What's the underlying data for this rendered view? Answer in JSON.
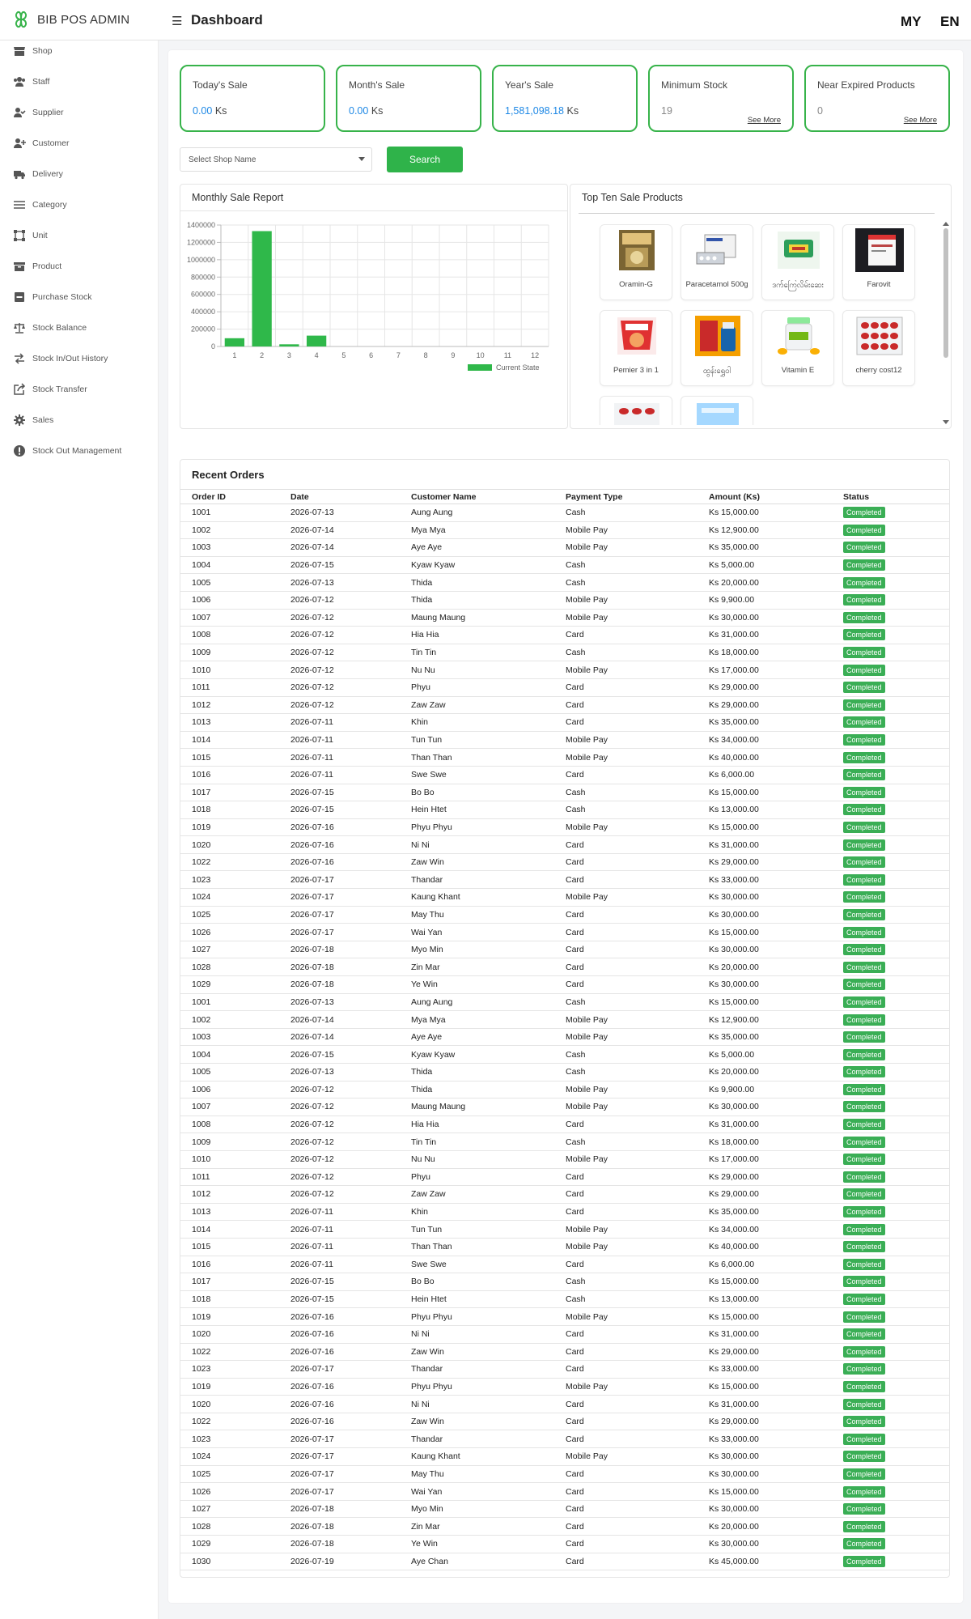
{
  "brand": {
    "name": "BIB POS ADMIN"
  },
  "header": {
    "title": "Dashboard",
    "lang_my": "MY",
    "lang_en": "EN"
  },
  "colors": {
    "accent": "#37b34a",
    "link": "#1e88e5",
    "badge": "#3aae55"
  },
  "sidebar": {
    "items": [
      {
        "label": "Shop",
        "icon": "store-icon"
      },
      {
        "label": "Staff",
        "icon": "users-icon"
      },
      {
        "label": "Supplier",
        "icon": "user-check-icon"
      },
      {
        "label": "Customer",
        "icon": "user-plus-icon"
      },
      {
        "label": "Delivery",
        "icon": "truck-icon"
      },
      {
        "label": "Category",
        "icon": "bars-icon"
      },
      {
        "label": "Unit",
        "icon": "vector-square-icon"
      },
      {
        "label": "Product",
        "icon": "box-icon"
      },
      {
        "label": "Purchase Stock",
        "icon": "minus-square-icon"
      },
      {
        "label": "Stock Balance",
        "icon": "scale-icon"
      },
      {
        "label": "Stock In/Out History",
        "icon": "exchange-icon"
      },
      {
        "label": "Stock Transfer",
        "icon": "share-square-icon"
      },
      {
        "label": "Sales",
        "icon": "cog-icon"
      },
      {
        "label": "Stock Out Management",
        "icon": "exclamation-circle-icon"
      }
    ]
  },
  "stats": {
    "today": {
      "title": "Today's Sale",
      "value": "0.00",
      "unit": "Ks"
    },
    "month": {
      "title": "Month's Sale",
      "value": "0.00",
      "unit": "Ks"
    },
    "year": {
      "title": "Year's Sale",
      "value": "1,581,098.18",
      "unit": "Ks"
    },
    "min_stock": {
      "title": "Minimum Stock",
      "value": "19",
      "link": "See More"
    },
    "near_expired": {
      "title": "Near Expired Products",
      "value": "0",
      "link": "See More"
    }
  },
  "filters": {
    "shop_placeholder": "Select Shop Name",
    "search_label": "Search"
  },
  "monthly_report": {
    "title": "Monthly Sale Report"
  },
  "chart_data": {
    "type": "bar",
    "categories": [
      "1",
      "2",
      "3",
      "4",
      "5",
      "6",
      "7",
      "8",
      "9",
      "10",
      "11",
      "12"
    ],
    "series": [
      {
        "name": "Current State",
        "color": "#2fb84a",
        "values": [
          95000,
          1330000,
          25000,
          125000,
          0,
          0,
          0,
          0,
          0,
          0,
          0,
          0
        ]
      }
    ],
    "yticks": [
      "0",
      "200000",
      "400000",
      "600000",
      "800000",
      "1000000",
      "1200000",
      "1400000"
    ],
    "ylim": [
      0,
      1400000
    ],
    "grid": true,
    "legend": "bottom-right"
  },
  "top_products": {
    "title": "Top Ten Sale Products",
    "items": [
      {
        "name": "Oramin-G"
      },
      {
        "name": "Paracetamol 500g"
      },
      {
        "name": "ဒက်ကြေလိမ်းဆေး"
      },
      {
        "name": "Farovit"
      },
      {
        "name": "Pemier 3 in 1"
      },
      {
        "name": "ထွန်းရွှေဝါ"
      },
      {
        "name": "Vitamin E"
      },
      {
        "name": "cherry cost12"
      },
      {
        "name": ""
      },
      {
        "name": ""
      }
    ]
  },
  "orders": {
    "title": "Recent Orders",
    "columns": [
      "Order ID",
      "Date",
      "Customer Name",
      "Payment Type",
      "Amount (Ks)",
      "Status"
    ],
    "rows": [
      [
        "1001",
        "2026-07-13",
        "Aung Aung",
        "Cash",
        "Ks 15,000.00",
        "Completed"
      ],
      [
        "1002",
        "2026-07-14",
        "Mya Mya",
        "Mobile Pay",
        "Ks 12,900.00",
        "Completed"
      ],
      [
        "1003",
        "2026-07-14",
        "Aye Aye",
        "Mobile Pay",
        "Ks 35,000.00",
        "Completed"
      ],
      [
        "1004",
        "2026-07-15",
        "Kyaw Kyaw",
        "Cash",
        "Ks 5,000.00",
        "Completed"
      ],
      [
        "1005",
        "2026-07-13",
        "Thida",
        "Cash",
        "Ks 20,000.00",
        "Completed"
      ],
      [
        "1006",
        "2026-07-12",
        "Thida",
        "Mobile Pay",
        "Ks 9,900.00",
        "Completed"
      ],
      [
        "1007",
        "2026-07-12",
        "Maung Maung",
        "Mobile Pay",
        "Ks 30,000.00",
        "Completed"
      ],
      [
        "1008",
        "2026-07-12",
        "Hia Hia",
        "Card",
        "Ks 31,000.00",
        "Completed"
      ],
      [
        "1009",
        "2026-07-12",
        "Tin Tin",
        "Cash",
        "Ks 18,000.00",
        "Completed"
      ],
      [
        "1010",
        "2026-07-12",
        "Nu Nu",
        "Mobile Pay",
        "Ks 17,000.00",
        "Completed"
      ],
      [
        "1011",
        "2026-07-12",
        "Phyu",
        "Card",
        "Ks 29,000.00",
        "Completed"
      ],
      [
        "1012",
        "2026-07-12",
        "Zaw Zaw",
        "Card",
        "Ks 29,000.00",
        "Completed"
      ],
      [
        "1013",
        "2026-07-11",
        "Khin",
        "Card",
        "Ks 35,000.00",
        "Completed"
      ],
      [
        "1014",
        "2026-07-11",
        "Tun Tun",
        "Mobile Pay",
        "Ks 34,000.00",
        "Completed"
      ],
      [
        "1015",
        "2026-07-11",
        "Than Than",
        "Mobile Pay",
        "Ks 40,000.00",
        "Completed"
      ],
      [
        "1016",
        "2026-07-11",
        "Swe Swe",
        "Card",
        "Ks 6,000.00",
        "Completed"
      ],
      [
        "1017",
        "2026-07-15",
        "Bo Bo",
        "Cash",
        "Ks 15,000.00",
        "Completed"
      ],
      [
        "1018",
        "2026-07-15",
        "Hein Htet",
        "Cash",
        "Ks 13,000.00",
        "Completed"
      ],
      [
        "1019",
        "2026-07-16",
        "Phyu Phyu",
        "Mobile Pay",
        "Ks 15,000.00",
        "Completed"
      ],
      [
        "1020",
        "2026-07-16",
        "Ni Ni",
        "Card",
        "Ks 31,000.00",
        "Completed"
      ],
      [
        "1022",
        "2026-07-16",
        "Zaw Win",
        "Card",
        "Ks 29,000.00",
        "Completed"
      ],
      [
        "1023",
        "2026-07-17",
        "Thandar",
        "Card",
        "Ks 33,000.00",
        "Completed"
      ],
      [
        "1024",
        "2026-07-17",
        "Kaung Khant",
        "Mobile Pay",
        "Ks 30,000.00",
        "Completed"
      ],
      [
        "1025",
        "2026-07-17",
        "May Thu",
        "Card",
        "Ks 30,000.00",
        "Completed"
      ],
      [
        "1026",
        "2026-07-17",
        "Wai Yan",
        "Card",
        "Ks 15,000.00",
        "Completed"
      ],
      [
        "1027",
        "2026-07-18",
        "Myo Min",
        "Card",
        "Ks 30,000.00",
        "Completed"
      ],
      [
        "1028",
        "2026-07-18",
        "Zin Mar",
        "Card",
        "Ks 20,000.00",
        "Completed"
      ],
      [
        "1029",
        "2026-07-18",
        "Ye Win",
        "Card",
        "Ks 30,000.00",
        "Completed"
      ],
      [
        "1001",
        "2026-07-13",
        "Aung Aung",
        "Cash",
        "Ks 15,000.00",
        "Completed"
      ],
      [
        "1002",
        "2026-07-14",
        "Mya Mya",
        "Mobile Pay",
        "Ks 12,900.00",
        "Completed"
      ],
      [
        "1003",
        "2026-07-14",
        "Aye Aye",
        "Mobile Pay",
        "Ks 35,000.00",
        "Completed"
      ],
      [
        "1004",
        "2026-07-15",
        "Kyaw Kyaw",
        "Cash",
        "Ks 5,000.00",
        "Completed"
      ],
      [
        "1005",
        "2026-07-13",
        "Thida",
        "Cash",
        "Ks 20,000.00",
        "Completed"
      ],
      [
        "1006",
        "2026-07-12",
        "Thida",
        "Mobile Pay",
        "Ks 9,900.00",
        "Completed"
      ],
      [
        "1007",
        "2026-07-12",
        "Maung Maung",
        "Mobile Pay",
        "Ks 30,000.00",
        "Completed"
      ],
      [
        "1008",
        "2026-07-12",
        "Hia Hia",
        "Card",
        "Ks 31,000.00",
        "Completed"
      ],
      [
        "1009",
        "2026-07-12",
        "Tin Tin",
        "Cash",
        "Ks 18,000.00",
        "Completed"
      ],
      [
        "1010",
        "2026-07-12",
        "Nu Nu",
        "Mobile Pay",
        "Ks 17,000.00",
        "Completed"
      ],
      [
        "1011",
        "2026-07-12",
        "Phyu",
        "Card",
        "Ks 29,000.00",
        "Completed"
      ],
      [
        "1012",
        "2026-07-12",
        "Zaw Zaw",
        "Card",
        "Ks 29,000.00",
        "Completed"
      ],
      [
        "1013",
        "2026-07-11",
        "Khin",
        "Card",
        "Ks 35,000.00",
        "Completed"
      ],
      [
        "1014",
        "2026-07-11",
        "Tun Tun",
        "Mobile Pay",
        "Ks 34,000.00",
        "Completed"
      ],
      [
        "1015",
        "2026-07-11",
        "Than Than",
        "Mobile Pay",
        "Ks 40,000.00",
        "Completed"
      ],
      [
        "1016",
        "2026-07-11",
        "Swe Swe",
        "Card",
        "Ks 6,000.00",
        "Completed"
      ],
      [
        "1017",
        "2026-07-15",
        "Bo Bo",
        "Cash",
        "Ks 15,000.00",
        "Completed"
      ],
      [
        "1018",
        "2026-07-15",
        "Hein Htet",
        "Cash",
        "Ks 13,000.00",
        "Completed"
      ],
      [
        "1019",
        "2026-07-16",
        "Phyu Phyu",
        "Mobile Pay",
        "Ks 15,000.00",
        "Completed"
      ],
      [
        "1020",
        "2026-07-16",
        "Ni Ni",
        "Card",
        "Ks 31,000.00",
        "Completed"
      ],
      [
        "1022",
        "2026-07-16",
        "Zaw Win",
        "Card",
        "Ks 29,000.00",
        "Completed"
      ],
      [
        "1023",
        "2026-07-17",
        "Thandar",
        "Card",
        "Ks 33,000.00",
        "Completed"
      ],
      [
        "1019",
        "2026-07-16",
        "Phyu Phyu",
        "Mobile Pay",
        "Ks 15,000.00",
        "Completed"
      ],
      [
        "1020",
        "2026-07-16",
        "Ni Ni",
        "Card",
        "Ks 31,000.00",
        "Completed"
      ],
      [
        "1022",
        "2026-07-16",
        "Zaw Win",
        "Card",
        "Ks 29,000.00",
        "Completed"
      ],
      [
        "1023",
        "2026-07-17",
        "Thandar",
        "Card",
        "Ks 33,000.00",
        "Completed"
      ],
      [
        "1024",
        "2026-07-17",
        "Kaung Khant",
        "Mobile Pay",
        "Ks 30,000.00",
        "Completed"
      ],
      [
        "1025",
        "2026-07-17",
        "May Thu",
        "Card",
        "Ks 30,000.00",
        "Completed"
      ],
      [
        "1026",
        "2026-07-17",
        "Wai Yan",
        "Card",
        "Ks 15,000.00",
        "Completed"
      ],
      [
        "1027",
        "2026-07-18",
        "Myo Min",
        "Card",
        "Ks 30,000.00",
        "Completed"
      ],
      [
        "1028",
        "2026-07-18",
        "Zin Mar",
        "Card",
        "Ks 20,000.00",
        "Completed"
      ],
      [
        "1029",
        "2026-07-18",
        "Ye Win",
        "Card",
        "Ks 30,000.00",
        "Completed"
      ],
      [
        "1030",
        "2026-07-19",
        "Aye Chan",
        "Card",
        "Ks 45,000.00",
        "Completed"
      ]
    ]
  }
}
